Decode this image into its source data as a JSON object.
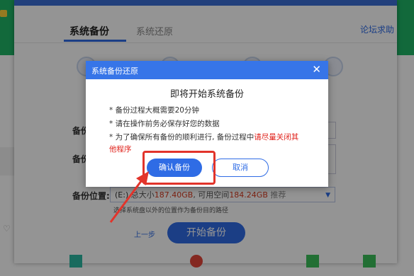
{
  "main": {
    "tab_backup": "系统备份",
    "tab_restore": "系统还原",
    "forum_link": "论坛求助",
    "label_1": "备份",
    "label_2": "备份",
    "location_label": "备份位置:",
    "location_drive": "(E:)",
    "location_total_prefix": "总大小",
    "location_total": "187.40GB",
    "location_free_prefix": ", 可用空间",
    "location_free": "184.24GB",
    "location_recommend": "推荐",
    "location_hint": "选择系统盘以外的位置作为备份目的路径",
    "prev_step": "上一步",
    "start_backup": "开始备份"
  },
  "dialog": {
    "title": "系统备份还原",
    "heading": "即将开始系统备份",
    "line1": "* 备份过程大概需要20分钟",
    "line2": "* 请在操作前务必保存好您的数据",
    "line3_prefix": "* 为了确保所有备份的顺利进行, 备份过程中",
    "line3_red": "请尽量关闭其",
    "line4_red": "他程序",
    "confirm": "确认备份",
    "cancel": "取消"
  },
  "colors": {
    "accent": "#2f6ce5",
    "dialog_header": "#3775e8",
    "highlight": "#e2342b",
    "warning_text": "#e0221b"
  }
}
